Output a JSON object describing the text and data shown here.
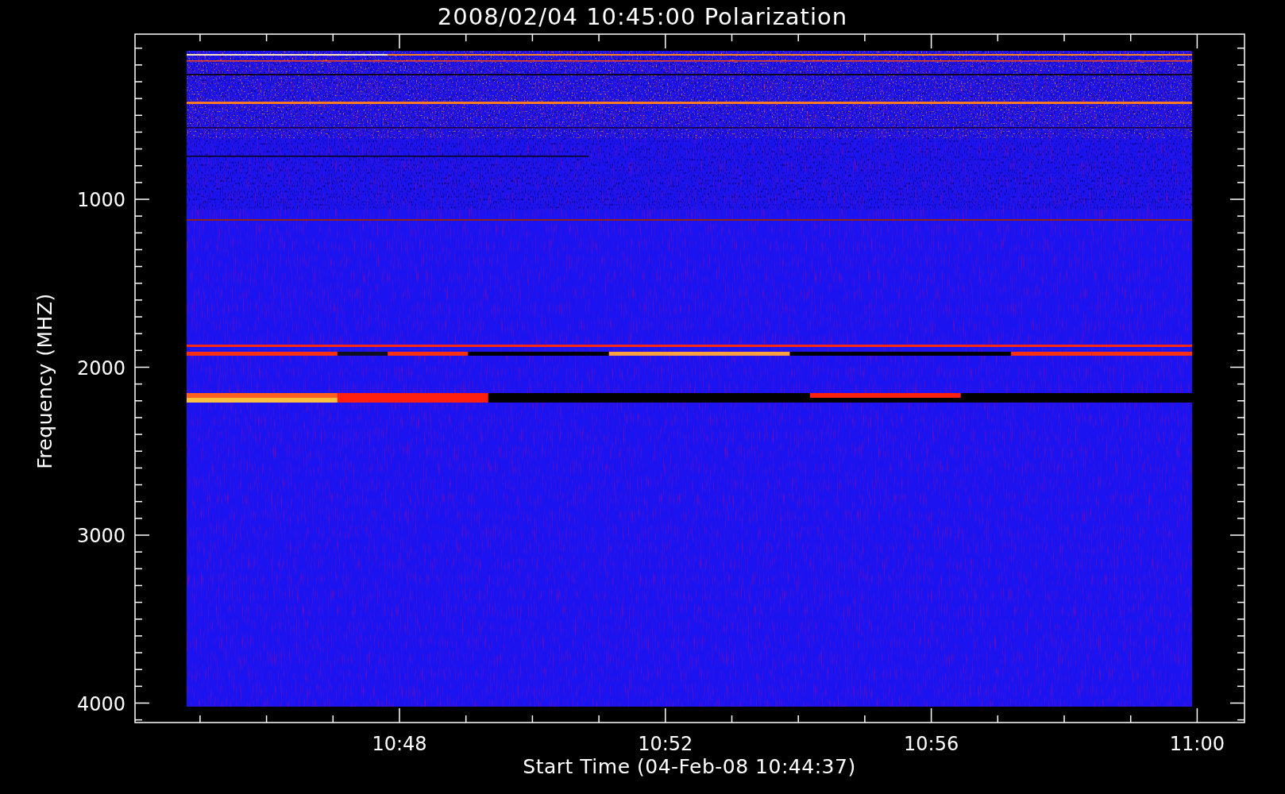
{
  "title": "2008/02/04 10:45:00 Polarization",
  "y_axis": {
    "label": "Frequency (MHZ)",
    "tick_labels": [
      "1000",
      "2000",
      "3000",
      "4000"
    ]
  },
  "x_axis": {
    "label": "Start Time (04-Feb-08 10:44:37)",
    "tick_labels": [
      "10:48",
      "10:52",
      "10:56",
      "11:00"
    ]
  }
}
